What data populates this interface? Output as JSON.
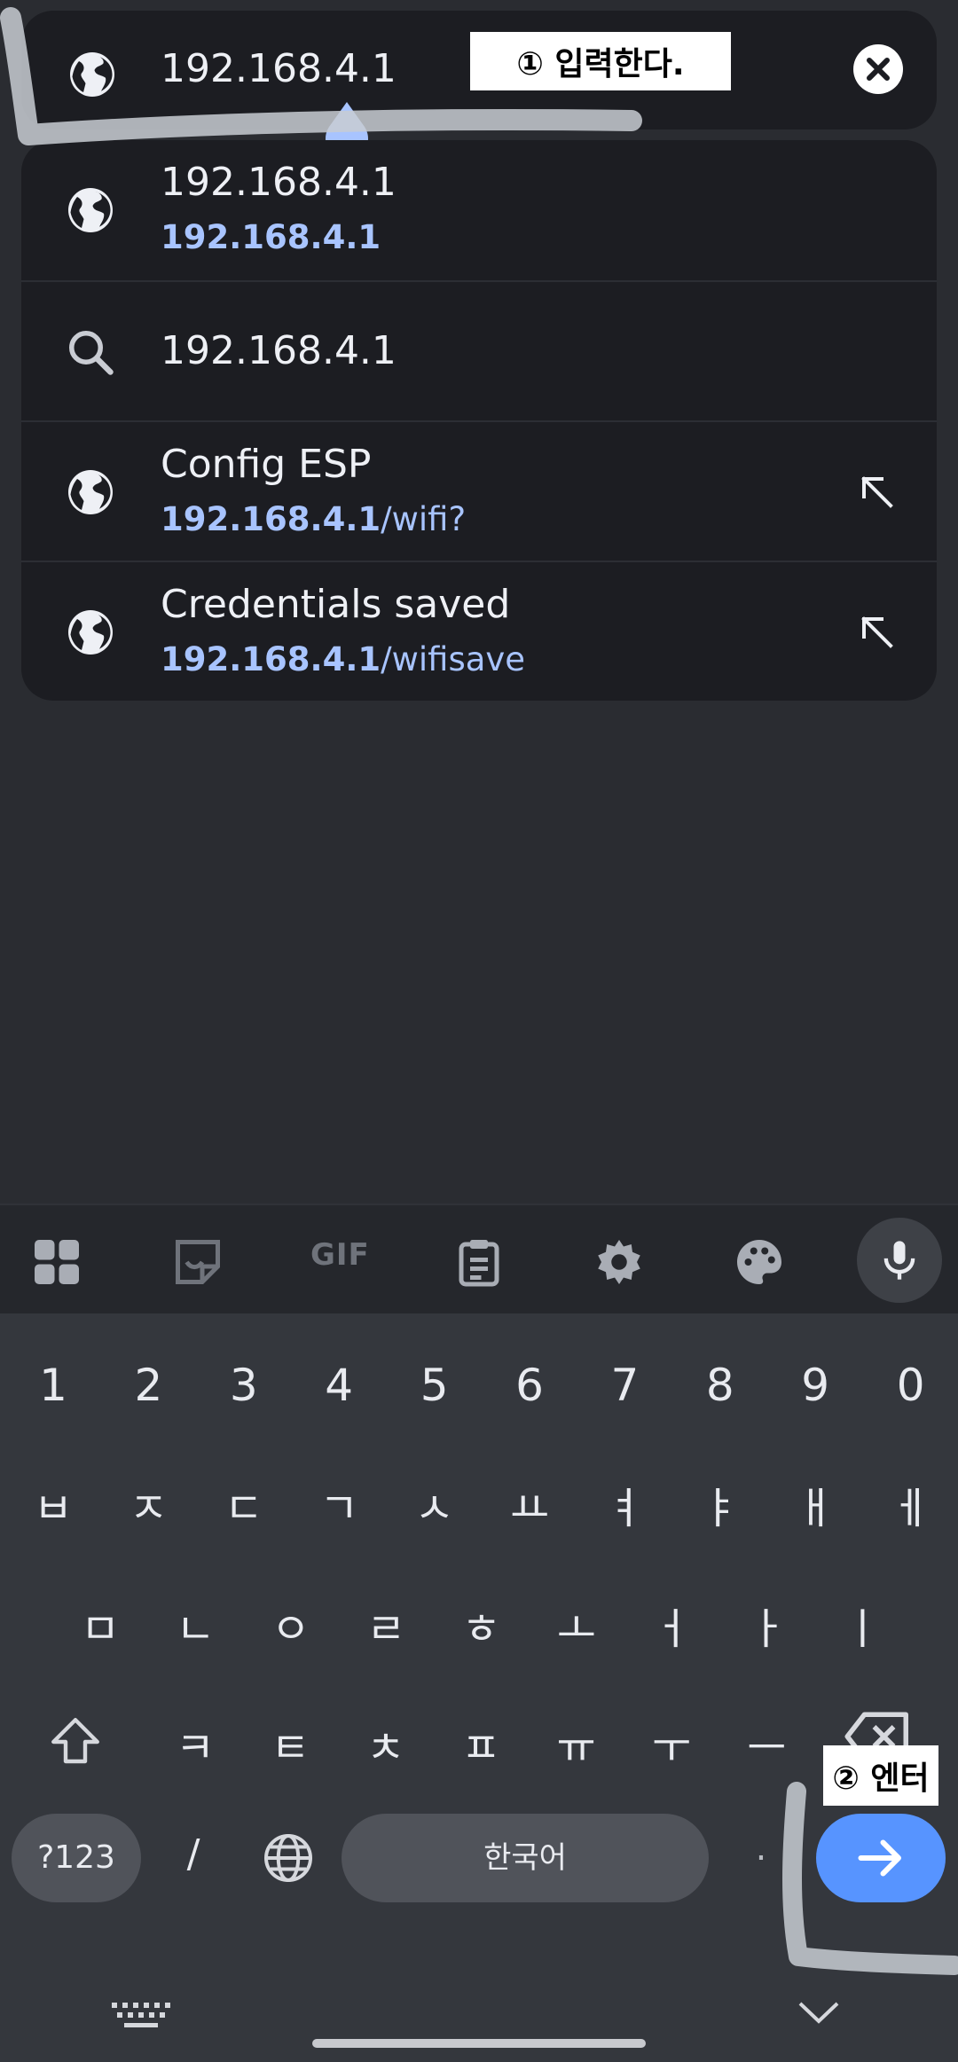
{
  "url_bar": {
    "value": "192.168.4.1"
  },
  "suggestions": [
    {
      "icon": "globe-icon",
      "title": "192.168.4.1",
      "url_bold": "192.168.4.1",
      "url_rest": ""
    },
    {
      "icon": "search-icon",
      "title": "192.168.4.1"
    },
    {
      "icon": "globe-icon",
      "title": "Config ESP",
      "url_bold": "192.168.4.1",
      "url_rest": "/wifi?"
    },
    {
      "icon": "globe-icon",
      "title": "Credentials saved",
      "url_bold": "192.168.4.1",
      "url_rest": "/wifisave"
    }
  ],
  "keyboard": {
    "toolbar": [
      "apps-grid-icon",
      "sticker-icon",
      "gif-icon",
      "clipboard-icon",
      "settings-gear-icon",
      "theme-palette-icon",
      "microphone-icon"
    ],
    "gif_label": "GIF",
    "row_numbers": [
      "1",
      "2",
      "3",
      "4",
      "5",
      "6",
      "7",
      "8",
      "9",
      "0"
    ],
    "row1": [
      "ㅂ",
      "ㅈ",
      "ㄷ",
      "ㄱ",
      "ㅅ",
      "ㅛ",
      "ㅕ",
      "ㅑ",
      "ㅐ",
      "ㅔ"
    ],
    "row2": [
      "ㅁ",
      "ㄴ",
      "ㅇ",
      "ㄹ",
      "ㅎ",
      "ㅗ",
      "ㅓ",
      "ㅏ",
      "ㅣ"
    ],
    "row3": [
      "ㅋ",
      "ㅌ",
      "ㅊ",
      "ㅍ",
      "ㅠ",
      "ㅜ",
      "ㅡ"
    ],
    "symbols_key": "?123",
    "slash_key": "/",
    "space_label": "한국어",
    "period_key": "."
  },
  "annotations": {
    "note1": "① 입력한다.",
    "note2": "② 엔터"
  },
  "colors": {
    "accent_blue": "#5794ff",
    "link_blue": "#a8c4ff",
    "surface": "#1c1d22"
  }
}
